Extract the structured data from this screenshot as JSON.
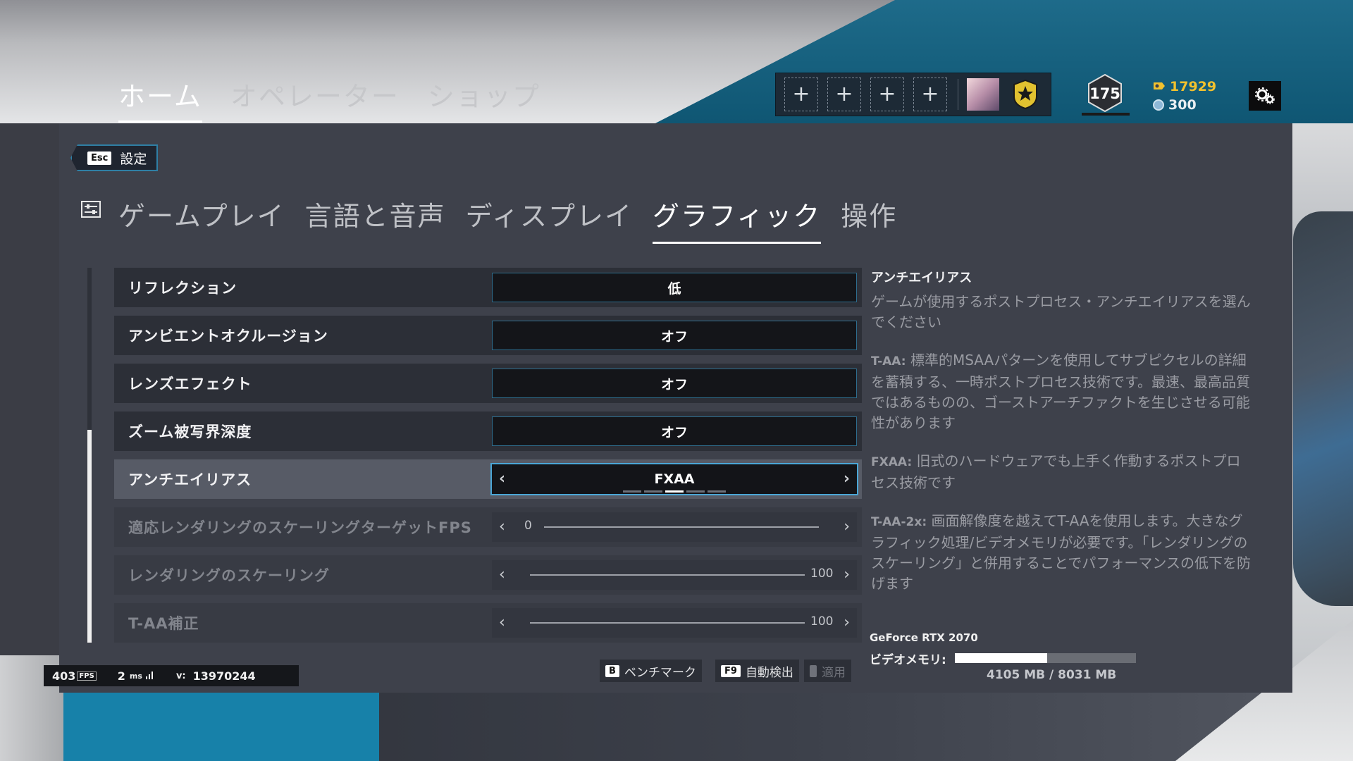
{
  "top_nav": {
    "tabs": [
      "ホーム",
      "オペレーター",
      "ショップ"
    ],
    "active": 0
  },
  "squad": {
    "slot_icon": "plus-icon",
    "slots": 4
  },
  "player": {
    "level": "175",
    "renown": "17929",
    "credits": "300"
  },
  "breadcrumb": {
    "key": "Esc",
    "label": "設定"
  },
  "settings_tabs": [
    "ゲームプレイ",
    "言語と音声",
    "ディスプレイ",
    "グラフィック",
    "操作"
  ],
  "active_settings_tab": 3,
  "rows": [
    {
      "label": "リフレクション",
      "value": "低"
    },
    {
      "label": "アンビエントオクルージョン",
      "value": "オフ"
    },
    {
      "label": "レンズエフェクト",
      "value": "オフ"
    },
    {
      "label": "ズーム被写界深度",
      "value": "オフ"
    },
    {
      "label": "アンチエイリアス",
      "value": "FXAA"
    },
    {
      "label": "適応レンダリングのスケーリングターゲットFPS",
      "value": "0"
    },
    {
      "label": "レンダリングのスケーリング",
      "value": "100"
    },
    {
      "label": "T-AA補正",
      "value": "100"
    }
  ],
  "antialias_option_index": 2,
  "antialias_option_count": 5,
  "description": {
    "title": "アンチエイリアス",
    "intro": "ゲームが使用するポストプロセス・アンチエイリアスを選んでください",
    "taa_label": "T-AA:",
    "taa": "標準的MSAAパターンを使用してサブピクセルの詳細を蓄積する、一時ポストプロセス技術です。最速、最高品質ではあるものの、ゴーストアーチファクトを生じさせる可能性があります",
    "fxaa_label": "FXAA:",
    "fxaa": "旧式のハードウェアでも上手く作動するポストプロセス技術です",
    "taa2x_label": "T-AA-2x:",
    "taa2x": "画面解像度を越えてT-AAを使用します。大きなグラフィック処理/ビデオメモリが必要です。「レンダリングのスケーリング」と併用することでパフォーマンスの低下を防げます"
  },
  "gpu": {
    "name": "GeForce RTX 2070",
    "vram_label": "ビデオメモリ:",
    "vram_used_mb": 4105,
    "vram_total_mb": 8031,
    "vram_text": "4105 MB / 8031 MB"
  },
  "buttons": {
    "benchmark": {
      "key": "B",
      "label": "ベンチマーク"
    },
    "autodetect": {
      "key": "F9",
      "label": "自動検出"
    },
    "apply": {
      "label": "適用"
    }
  },
  "stats": {
    "fps": "403",
    "fps_tag": "FPS",
    "ping": "2",
    "ping_unit": "ms",
    "version_label": "v:",
    "version": "13970244"
  }
}
